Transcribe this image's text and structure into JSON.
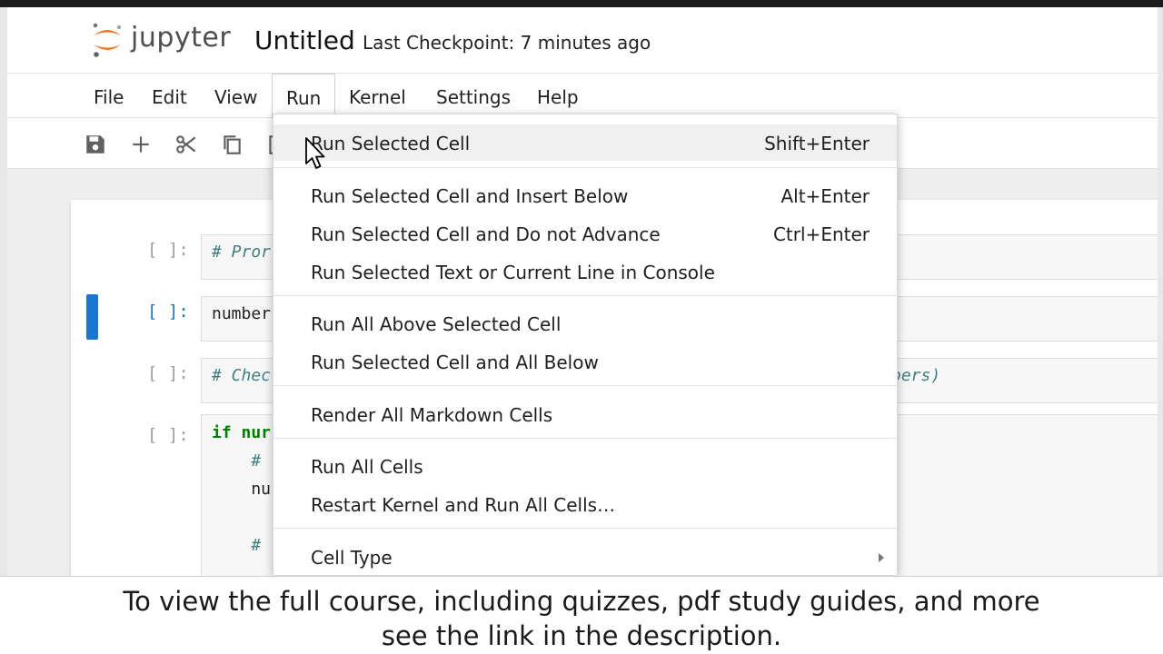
{
  "header": {
    "logo_text": "jupyter",
    "notebook_title": "Untitled",
    "checkpoint": "Last Checkpoint: 7 minutes ago"
  },
  "menubar": {
    "items": [
      "File",
      "Edit",
      "View",
      "Run",
      "Kernel",
      "Settings",
      "Help"
    ],
    "active": "Run"
  },
  "toolbar": {
    "icons": [
      "save-icon",
      "add-icon",
      "cut-icon",
      "copy-icon"
    ]
  },
  "cells": [
    {
      "prompt": "[ ]:",
      "code": "# Pror",
      "tail": ""
    },
    {
      "prompt": "[ ]:",
      "code": "number",
      "tail": ""
    },
    {
      "prompt": "[ ]:",
      "code": "# Chec",
      "tail": "bers)"
    },
    {
      "prompt": "[ ]:",
      "code_lines": [
        "if nur",
        "    #",
        "    nu",
        "",
        "    #"
      ]
    }
  ],
  "run_menu": {
    "items": [
      {
        "label": "Run Selected Cell",
        "shortcut": "Shift+Enter"
      },
      {
        "label": "Run Selected Cell and Insert Below",
        "shortcut": "Alt+Enter"
      },
      {
        "label": "Run Selected Cell and Do not Advance",
        "shortcut": "Ctrl+Enter"
      },
      {
        "label": "Run Selected Text or Current Line in Console",
        "shortcut": ""
      },
      {
        "label": "Run All Above Selected Cell",
        "shortcut": ""
      },
      {
        "label": "Run Selected Cell and All Below",
        "shortcut": ""
      },
      {
        "label": "Render All Markdown Cells",
        "shortcut": ""
      },
      {
        "label": "Run All Cells",
        "shortcut": ""
      },
      {
        "label": "Restart Kernel and Run All Cells…",
        "shortcut": ""
      },
      {
        "label": "Cell Type",
        "shortcut": ""
      }
    ],
    "hovered": "Run Selected Cell"
  },
  "caption": {
    "line1": "To view the full course, including quizzes, pdf study guides, and more",
    "line2": "see the link in the description."
  },
  "colors": {
    "accent": "#1976d2",
    "jupyter_orange": "#f37726",
    "comment": "#408080",
    "keyword": "#008000"
  }
}
